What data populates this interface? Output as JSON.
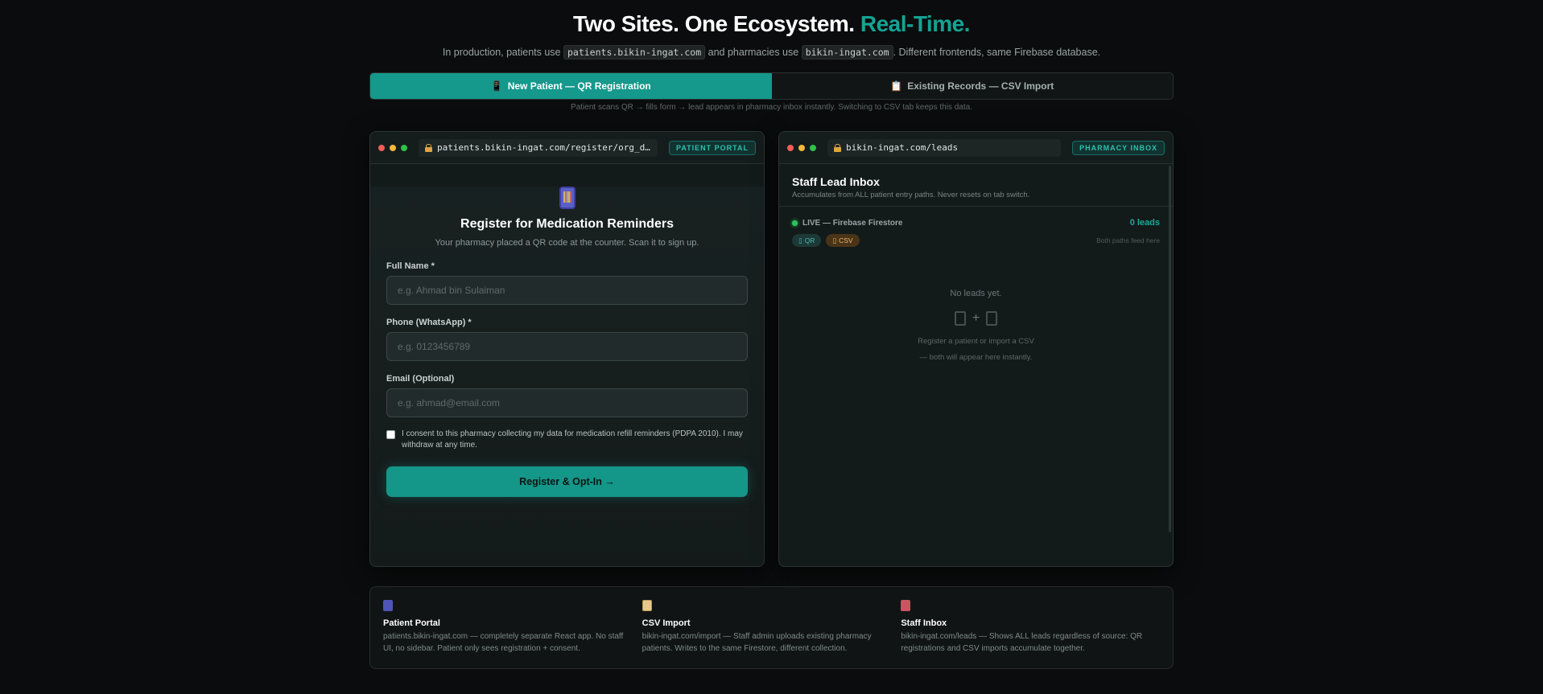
{
  "hero": {
    "title_main": "Two Sites. One Ecosystem.",
    "title_accent": "Real-Time.",
    "sub_prefix": "In production, patients use",
    "patient_domain": "patients.bikin-ingat.com",
    "sub_middle": "and pharmacies use",
    "pharmacy_domain": "bikin-ingat.com",
    "sub_suffix": ". Different frontends, same Firebase database."
  },
  "tabs": [
    {
      "icon": "📱",
      "label": "New Patient — QR Registration",
      "active": true
    },
    {
      "icon": "📋",
      "label": "Existing Records — CSV Import",
      "active": false
    }
  ],
  "tab_hint": "Patient scans QR → fills form → lead appears in pharmacy inbox instantly. Switching to CSV tab keeps this data.",
  "patient_window": {
    "url": "patients.bikin-ingat.com/register/org_default_p…",
    "badge": "PATIENT PORTAL",
    "title": "Register for Medication Reminders",
    "subtitle": "Your pharmacy placed a QR code at the counter. Scan it to sign up.",
    "fields": [
      {
        "label": "Full Name *",
        "placeholder": "e.g. Ahmad bin Sulaiman",
        "value": ""
      },
      {
        "label": "Phone (WhatsApp) *",
        "placeholder": "e.g. 0123456789",
        "value": ""
      },
      {
        "label": "Email (Optional)",
        "placeholder": "e.g. ahmad@email.com",
        "value": ""
      }
    ],
    "consent": "I consent to this pharmacy collecting my data for medication refill reminders (PDPA 2010). I may withdraw at any time.",
    "consent_checked": false,
    "submit": "Register & Opt-In →"
  },
  "pharmacy_window": {
    "url": "bikin-ingat.com/leads",
    "badge": "PHARMACY INBOX",
    "title": "Staff Lead Inbox",
    "subtitle": "Accumulates from ALL patient entry paths. Never resets on tab switch.",
    "live": "LIVE — Firebase Firestore",
    "lead_count": "0 leads",
    "chip_qr": "QR",
    "chip_csv": "CSV",
    "both_paths": "Both paths feed here",
    "empty_title": "No leads yet.",
    "plus": "+",
    "empty_hint_1": "Register a patient or import a CSV",
    "empty_hint_2": "— both will appear here instantly."
  },
  "info": [
    {
      "icon": "phone-icon",
      "title": "Patient Portal",
      "text": "patients.bikin-ingat.com — completely separate React app. No staff UI, no sidebar. Patient only sees registration + consent."
    },
    {
      "icon": "clipboard-icon",
      "title": "CSV Import",
      "text": "bikin-ingat.com/import — Staff admin uploads existing pharmacy patients. Writes to the same Firestore, different collection."
    },
    {
      "icon": "store-icon",
      "title": "Staff Inbox",
      "text": "bikin-ingat.com/leads — Shows ALL leads regardless of source: QR registrations and CSV imports accumulate together."
    }
  ],
  "colors": {
    "accent": "#14a394",
    "background": "#0b0c0d",
    "live": "#2fc25c"
  }
}
